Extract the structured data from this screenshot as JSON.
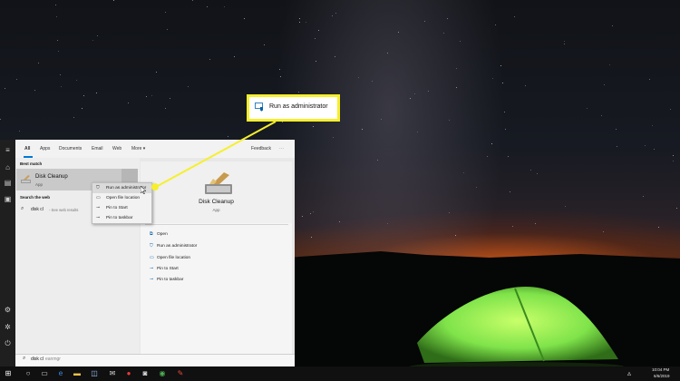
{
  "start_menu": {
    "tabs": [
      "All",
      "Apps",
      "Documents",
      "Email",
      "Web",
      "More"
    ],
    "more_caret": "▾",
    "feedback_label": "Feedback",
    "ellipsis": "···",
    "best_match_label": "Best match",
    "best_match": {
      "title": "Disk Cleanup",
      "subtitle": "App"
    },
    "search_web_label": "Search the web",
    "web_result": {
      "query": "disk cl",
      "hint": "- See web results"
    },
    "right_pane": {
      "title": "Disk Cleanup",
      "subtitle": "App",
      "actions": [
        "Open",
        "Run as administrator",
        "Open file location",
        "Pin to Start",
        "Pin to taskbar"
      ]
    },
    "search_box": {
      "typed": "disk cl",
      "ghost": "eanmgr"
    }
  },
  "context_menu": {
    "items": [
      "Run as administrator",
      "Open file location",
      "Pin to Start",
      "Pin to taskbar"
    ],
    "hovered_index": 0
  },
  "callout": {
    "text": "Run as administrator"
  },
  "taskbar": {
    "time": "10:04 PM",
    "date": "6/6/2019",
    "icons": [
      "windows-icon",
      "search-icon",
      "task-view-icon",
      "edge-icon",
      "file-explorer-icon",
      "store-icon",
      "mail-icon",
      "vivaldi-icon",
      "photos-icon",
      "chrome-icon",
      "paint-icon",
      "network-icon",
      "app-icon"
    ]
  },
  "colors": {
    "callout_border": "#f6ef2c",
    "accent": "#0078d7",
    "tent_green": "#7fe34a"
  }
}
